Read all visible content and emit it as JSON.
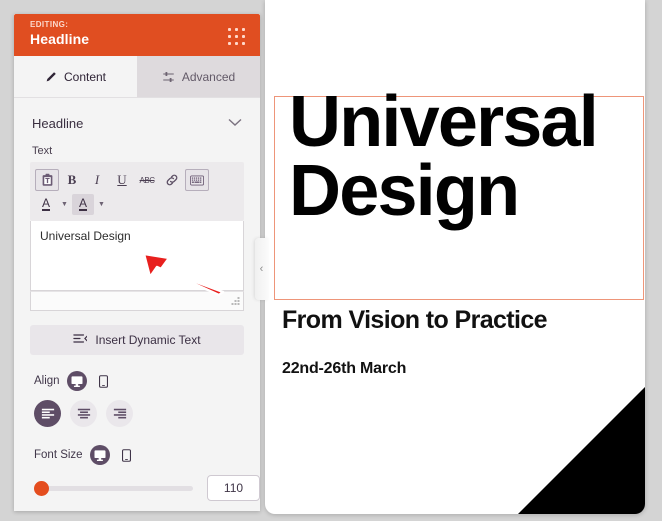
{
  "panel": {
    "editing_label": "EDITING:",
    "editing_value": "Headline",
    "drag_handle_icon": "grid-dots-icon",
    "tabs": [
      {
        "label": "Content",
        "icon": "pencil-icon",
        "active": true
      },
      {
        "label": "Advanced",
        "icon": "sliders-icon",
        "active": false
      }
    ],
    "section": {
      "title": "Headline",
      "chevron_icon": "chevron-down-icon"
    },
    "text_field": {
      "label": "Text",
      "value": "Universal Design",
      "placeholder": ""
    },
    "toolbar": {
      "row1": [
        {
          "name": "paste-icon",
          "label": "",
          "framed": true
        },
        {
          "name": "bold-icon",
          "label": "B",
          "framed": false
        },
        {
          "name": "italic-icon",
          "label": "I",
          "framed": false
        },
        {
          "name": "underline-icon",
          "label": "U",
          "framed": false
        },
        {
          "name": "strikethrough-icon",
          "label": "ABC",
          "framed": false
        },
        {
          "name": "link-icon",
          "label": "",
          "framed": false
        },
        {
          "name": "keyboard-icon",
          "label": "",
          "framed": true
        }
      ],
      "row2": [
        {
          "name": "font-color-icon",
          "label": "A",
          "highlighted": false
        },
        {
          "name": "highlight-color-icon",
          "label": "A",
          "highlighted": true
        }
      ],
      "dropdown_icon": "caret-down-icon"
    },
    "dynamic_text_button": {
      "label": "Insert Dynamic Text",
      "icon": "dynamic-text-icon"
    },
    "align": {
      "label": "Align",
      "devices": [
        {
          "name": "desktop-icon",
          "active": true
        },
        {
          "name": "mobile-icon",
          "active": false
        }
      ],
      "options": [
        {
          "name": "align-left-icon",
          "active": true
        },
        {
          "name": "align-center-icon",
          "active": false
        },
        {
          "name": "align-right-icon",
          "active": false
        }
      ]
    },
    "font_size": {
      "label": "Font Size",
      "devices": [
        {
          "name": "desktop-icon",
          "active": true
        },
        {
          "name": "mobile-icon",
          "active": false
        }
      ],
      "value": "110",
      "slider_percent": 0
    }
  },
  "collapse_handle": {
    "icon": "chevron-left-icon",
    "glyph": "‹"
  },
  "canvas": {
    "headline": "Universal\nDesign",
    "subheadline": "From Vision to Practice",
    "dateline": "22nd-26th March",
    "selection_color": "#ee9579",
    "corner_shape": "black-triangle"
  },
  "annotation": {
    "type": "red-arrow",
    "color": "#e8201e",
    "points_to": "headline-textarea"
  },
  "colors": {
    "brand_orange": "#e04e21",
    "accent_purple": "#5e4d66",
    "panel_bg": "#f4f4f4",
    "app_bg": "#d4d4d4"
  }
}
